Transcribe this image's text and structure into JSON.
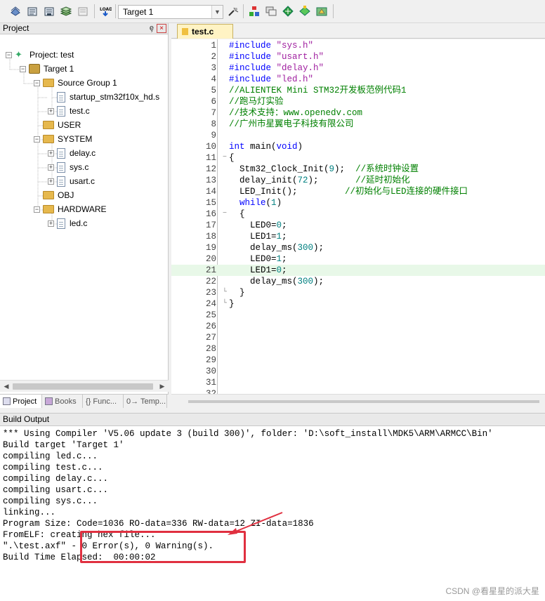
{
  "toolbar": {
    "target": "Target 1",
    "icons": [
      "translate-icon",
      "build-icon",
      "rebuild-icon",
      "batch-build-icon",
      "stop-build-icon",
      "download-icon",
      "target-options-icon",
      "manage-project-icon",
      "file-extensions-icon",
      "select-packs-icon",
      "pack-installer-icon",
      "manage-run-time-icon"
    ]
  },
  "project_panel": {
    "title": "Project",
    "pin": "ȩ",
    "close": "×",
    "tree": [
      {
        "label": "Project: test",
        "type": "project",
        "expander": "−"
      },
      {
        "label": "Target 1",
        "type": "target",
        "expander": "−"
      },
      {
        "label": "Source Group 1",
        "type": "folder",
        "expander": "−"
      },
      {
        "label": "startup_stm32f10x_hd.s",
        "type": "file",
        "expander": ""
      },
      {
        "label": "test.c",
        "type": "file",
        "expander": "+"
      },
      {
        "label": "USER",
        "type": "folder",
        "expander": ""
      },
      {
        "label": "SYSTEM",
        "type": "folder",
        "expander": "−"
      },
      {
        "label": "delay.c",
        "type": "file",
        "expander": "+"
      },
      {
        "label": "sys.c",
        "type": "file",
        "expander": "+"
      },
      {
        "label": "usart.c",
        "type": "file",
        "expander": "+"
      },
      {
        "label": "OBJ",
        "type": "folder",
        "expander": ""
      },
      {
        "label": "HARDWARE",
        "type": "folder",
        "expander": "−"
      },
      {
        "label": "led.c",
        "type": "file",
        "expander": "+"
      }
    ],
    "tabs": [
      "Project",
      "Books",
      "{} Func...",
      "0→ Temp..."
    ]
  },
  "editor": {
    "tab": "test.c",
    "highlight_line": 21,
    "lines": [
      [
        [
          "pp",
          "#include "
        ],
        [
          "str",
          "\"sys.h\""
        ]
      ],
      [
        [
          "pp",
          "#include "
        ],
        [
          "str",
          "\"usart.h\""
        ]
      ],
      [
        [
          "pp",
          "#include "
        ],
        [
          "str",
          "\"delay.h\""
        ]
      ],
      [
        [
          "pp",
          "#include "
        ],
        [
          "str",
          "\"led.h\""
        ]
      ],
      [
        [
          "cm",
          "//ALIENTEK Mini STM32开发板范例代码1"
        ]
      ],
      [
        [
          "cm",
          "//跑马灯实验"
        ]
      ],
      [
        [
          "cm",
          "//技术支持：www.openedv.com"
        ]
      ],
      [
        [
          "cm",
          "//广州市星翼电子科技有限公司"
        ]
      ],
      [],
      [
        [
          "kw",
          "int"
        ],
        [
          "",
          " main("
        ],
        [
          "kw",
          "void"
        ],
        [
          "",
          ")"
        ]
      ],
      [
        [
          "",
          "{"
        ]
      ],
      [
        [
          "",
          "  Stm32_Clock_Init("
        ],
        [
          "num",
          "9"
        ],
        [
          "",
          ");  "
        ],
        [
          "cm",
          "//系统时钟设置"
        ]
      ],
      [
        [
          "",
          "  delay_init("
        ],
        [
          "num",
          "72"
        ],
        [
          "",
          ");       "
        ],
        [
          "cm",
          "//延时初始化"
        ]
      ],
      [
        [
          "",
          "  LED_Init();         "
        ],
        [
          "cm",
          "//初始化与LED连接的硬件接口"
        ]
      ],
      [
        [
          "",
          "  "
        ],
        [
          "kw",
          "while"
        ],
        [
          "",
          "("
        ],
        [
          "num",
          "1"
        ],
        [
          "",
          ")"
        ]
      ],
      [
        [
          "",
          "  {"
        ]
      ],
      [
        [
          "",
          "    LED0="
        ],
        [
          "num",
          "0"
        ],
        [
          "",
          ";"
        ]
      ],
      [
        [
          "",
          "    LED1="
        ],
        [
          "num",
          "1"
        ],
        [
          "",
          ";"
        ]
      ],
      [
        [
          "",
          "    delay_ms("
        ],
        [
          "num",
          "300"
        ],
        [
          "",
          ");"
        ]
      ],
      [
        [
          "",
          "    LED0="
        ],
        [
          "num",
          "1"
        ],
        [
          "",
          ";"
        ]
      ],
      [
        [
          "",
          "    LED1="
        ],
        [
          "num",
          "0"
        ],
        [
          "",
          ";"
        ]
      ],
      [
        [
          "",
          "    delay_ms("
        ],
        [
          "num",
          "300"
        ],
        [
          "",
          ");"
        ]
      ],
      [
        [
          "",
          "  }"
        ]
      ],
      [
        [
          "",
          "}"
        ]
      ],
      [],
      [],
      [],
      [],
      [],
      [],
      [],
      []
    ],
    "fold_marks": {
      "11": "−",
      "16": "−",
      "23": "└",
      "24": "└"
    }
  },
  "build_output": {
    "title": "Build Output",
    "lines": [
      "*** Using Compiler 'V5.06 update 3 (build 300)', folder: 'D:\\soft_install\\MDK5\\ARM\\ARMCC\\Bin'",
      "Build target 'Target 1'",
      "compiling led.c...",
      "compiling test.c...",
      "compiling delay.c...",
      "compiling usart.c...",
      "compiling sys.c...",
      "linking...",
      "Program Size: Code=1036 RO-data=336 RW-data=12 ZI-data=1836",
      "FromELF: creating hex file...",
      "\".\\test.axf\" - 0 Error(s), 0 Warning(s).",
      "Build Time Elapsed:  00:00:02"
    ]
  },
  "watermark": "CSDN @看星星的派大星",
  "colors": {
    "preprocessor": "#0000ff",
    "string": "#a020a0",
    "comment": "#008000",
    "number": "#008080",
    "annotation": "#e03040"
  }
}
